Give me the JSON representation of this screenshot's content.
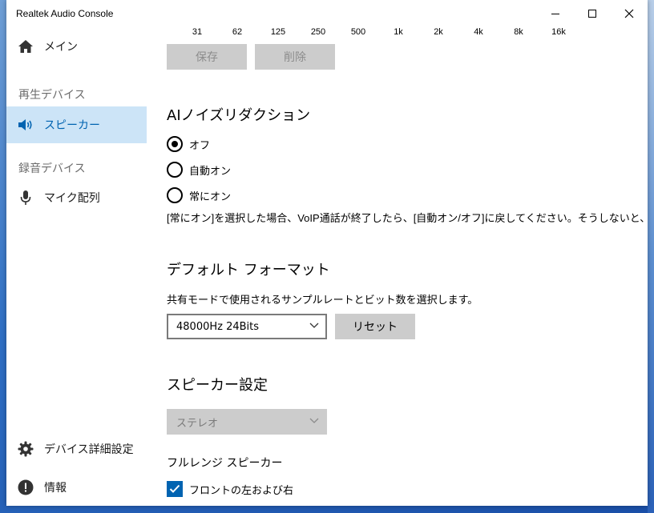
{
  "window": {
    "title": "Realtek Audio Console",
    "controls": {
      "minimize": "minimize",
      "maximize": "maximize",
      "close": "close"
    }
  },
  "sidebar": {
    "items": [
      {
        "label": "メイン",
        "icon": "home-icon"
      },
      {
        "label": "スピーカー",
        "icon": "speaker-icon",
        "selected": true
      },
      {
        "label": "マイク配列",
        "icon": "microphone-icon"
      },
      {
        "label": "デバイス詳細設定",
        "icon": "gear-icon"
      },
      {
        "label": "情報",
        "icon": "info-icon"
      }
    ],
    "headers": {
      "playback": "再生デバイス",
      "recording": "録音デバイス"
    }
  },
  "equalizer": {
    "frequencies": [
      "31",
      "62",
      "125",
      "250",
      "500",
      "1k",
      "2k",
      "4k",
      "8k",
      "16k"
    ],
    "save_label": "保存",
    "delete_label": "削除"
  },
  "noise_reduction": {
    "title": "AIノイズリダクション",
    "options": [
      "オフ",
      "自動オン",
      "常にオン"
    ],
    "selected": "オフ",
    "note": "[常にオン]を選択した場合、VoIP通話が終了したら、[自動オン/オフ]に戻してください。そうしないと、通常"
  },
  "default_format": {
    "title": "デフォルト フォーマット",
    "description": "共有モードで使用されるサンプルレートとビット数を選択します。",
    "selected": "48000Hz 24Bits",
    "reset_label": "リセット"
  },
  "speaker_settings": {
    "title": "スピーカー設定",
    "config": "ステレオ",
    "fullrange_title": "フルレンジ スピーカー",
    "front_lr_label": "フロントの左および右",
    "front_lr_checked": true
  },
  "colors": {
    "accent": "#0063b1",
    "selected_bg": "#cce4f7",
    "button_bg": "#cccccc"
  }
}
